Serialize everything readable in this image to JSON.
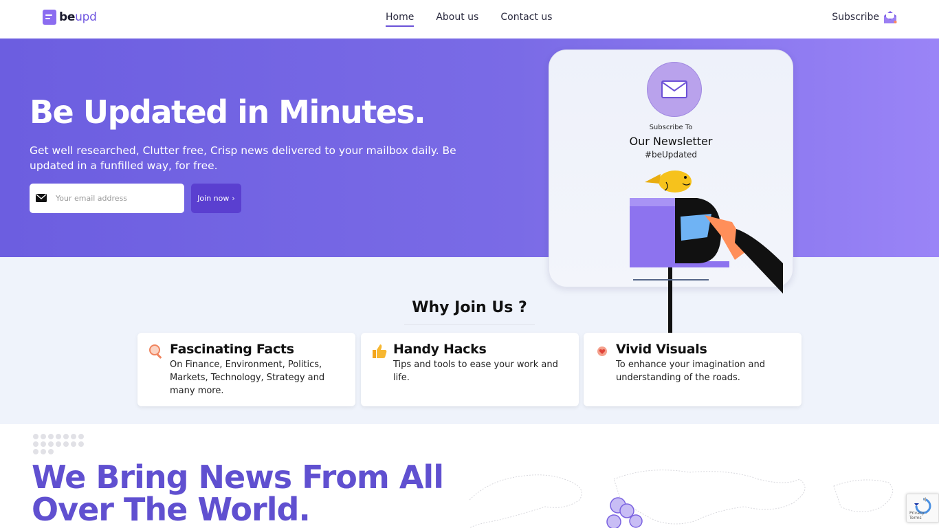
{
  "header": {
    "logo_part1": "be",
    "logo_part2": "upd",
    "nav": [
      {
        "label": "Home",
        "active": true
      },
      {
        "label": "About us",
        "active": false
      },
      {
        "label": "Contact us",
        "active": false
      }
    ],
    "subscribe_label": "Subscribe"
  },
  "hero": {
    "title": "Be Updated in Minutes.",
    "subtitle": "Get well researched, Clutter free, Crisp news delivered to your mailbox daily. Be updated in a funfilled way, for free.",
    "email_placeholder": "Your email address",
    "join_label": "Join now",
    "join_arrow": "›"
  },
  "newsletter": {
    "small_label": "Subscribe To",
    "title": "Our Newsletter",
    "tag": "#beUpdated"
  },
  "why": {
    "title": "Why Join Us ?",
    "cards": [
      {
        "icon": "magnifier-icon",
        "title": "Fascinating Facts",
        "text": "On Finance, Environment, Politics, Markets, Technology, Strategy and many more."
      },
      {
        "icon": "thumbs-up-icon",
        "title": "Handy Hacks",
        "text": "Tips and tools to ease your work and life."
      },
      {
        "icon": "heart-badge-icon",
        "title": "Vivid Visuals",
        "text": "To enhance your imagination and understanding of the roads."
      }
    ]
  },
  "world": {
    "title_line1": "We Bring News From All",
    "title_line2": "Over The World."
  },
  "recaptcha": {
    "text": "Privacy - Terms"
  },
  "colors": {
    "brand": "#6c5ee0",
    "accent": "#5a3fd0",
    "hero_end": "#9a84f7",
    "world_title": "#6050d0"
  }
}
